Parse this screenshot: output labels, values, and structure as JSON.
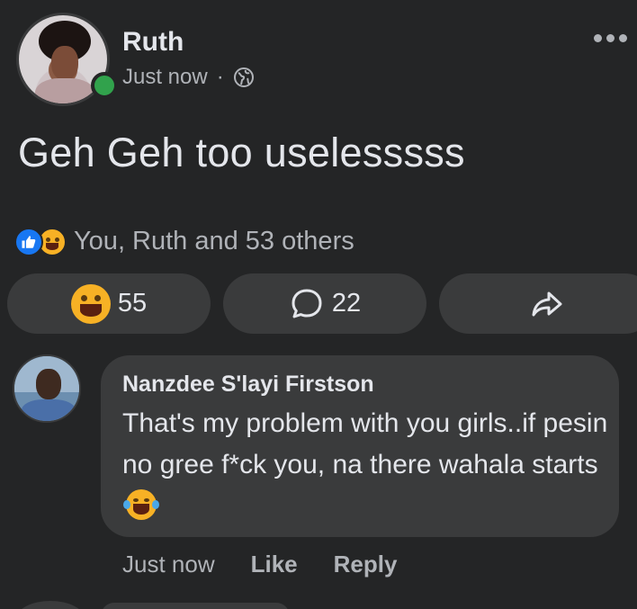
{
  "post": {
    "author": "Ruth",
    "time": "Just now",
    "separator": "·",
    "privacy_icon": "globe-icon",
    "text": "Geh Geh too uselesssss",
    "online": true
  },
  "reactions": {
    "summary": "You, Ruth and 53 others",
    "types": [
      "like",
      "haha"
    ]
  },
  "actions": {
    "reaction_count": "55",
    "comment_count": "22",
    "share_icon": "share-icon"
  },
  "comment": {
    "author": "Nanzdee S'layi Firstson",
    "text": "That's my problem with you girls..if pesin no gree f*ck you, na there wahala starts",
    "emoji": "laughing-tears-emoji",
    "time": "Just now",
    "like_label": "Like",
    "reply_label": "Reply"
  },
  "colors": {
    "background": "#242526",
    "bubble": "#3a3b3c",
    "like_blue": "#1877f2",
    "haha_yellow": "#f7b125",
    "online_green": "#31a24c"
  }
}
